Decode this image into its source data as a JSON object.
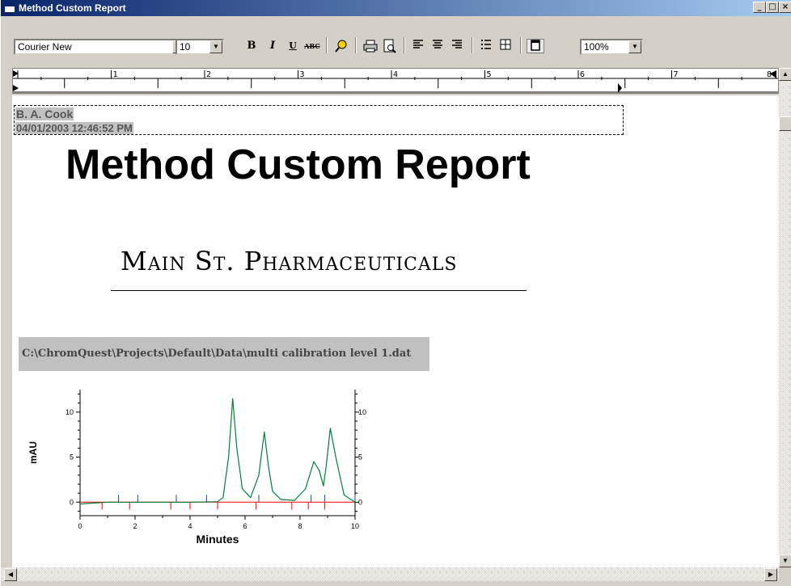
{
  "window": {
    "title": "Method Custom Report",
    "buttons": [
      "_",
      "□",
      "×"
    ]
  },
  "toolbar": {
    "font_name": "Courier New",
    "font_size": "10",
    "bold": "B",
    "italic": "I",
    "underline": "U",
    "strike": "ABC",
    "zoom": "100%"
  },
  "ruler": {
    "labels": [
      "1",
      "2",
      "3",
      "4",
      "5",
      "6",
      "7",
      "8"
    ]
  },
  "document": {
    "author": "B. A. Cook",
    "timestamp": "04/01/2003 12:46:52 PM",
    "title": "Method Custom Report",
    "company": "Main St. Pharmaceuticals",
    "file_path": "C:\\ChromQuest\\Projects\\Default\\Data\\multi calibration level 1.dat"
  },
  "chart_data": {
    "type": "line",
    "xlabel": "Minutes",
    "ylabel_left": "mAU",
    "ylabel_right": "mAU",
    "xlim": [
      0,
      10
    ],
    "ylim": [
      -1.5,
      12.5
    ],
    "x_ticks": [
      0,
      2,
      4,
      6,
      8,
      10
    ],
    "y_ticks": [
      0,
      5,
      10
    ],
    "series": [
      {
        "color": "#008040",
        "x": [
          0,
          1,
          2,
          3,
          4,
          5,
          5.2,
          5.4,
          5.55,
          5.7,
          5.9,
          6.2,
          6.5,
          6.7,
          6.85,
          7.0,
          7.3,
          7.8,
          8.2,
          8.5,
          8.7,
          8.85,
          8.95,
          9.1,
          9.3,
          9.6,
          10
        ],
        "y": [
          -0.2,
          0,
          0,
          0,
          0,
          0.05,
          0.5,
          5,
          11.5,
          6,
          1.5,
          0.5,
          3,
          7.8,
          4,
          1.2,
          0.3,
          0.2,
          1.5,
          4.5,
          3.5,
          1.8,
          4,
          8.2,
          5,
          0.8,
          0
        ]
      }
    ],
    "baseline": {
      "color": "#ff0000"
    },
    "markers_red": [
      0.8,
      1.8,
      3.3,
      4.0,
      5.0,
      6.4,
      7.7,
      8.3,
      8.9
    ],
    "markers_blue": [
      1.4,
      2.1,
      3.5,
      4.6,
      6.5,
      8.4,
      8.9,
      10
    ]
  }
}
